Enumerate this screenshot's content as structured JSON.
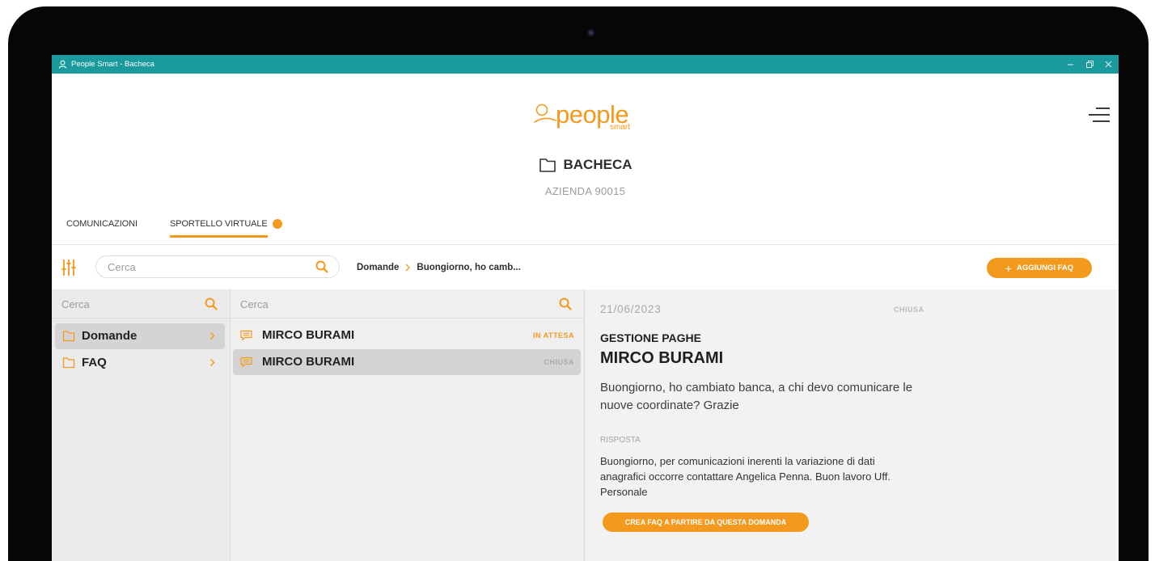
{
  "window": {
    "title": "People Smart - Bacheca"
  },
  "logo": {
    "word": "people",
    "sub": "smart"
  },
  "header": {
    "section_title": "BACHECA",
    "company": "AZIENDA 90015"
  },
  "tabs": [
    {
      "label": "COMUNICAZIONI",
      "active": false
    },
    {
      "label": "SPORTELLO VIRTUALE",
      "active": true,
      "has_badge": true
    }
  ],
  "toolbar": {
    "search_placeholder": "Cerca",
    "breadcrumb": [
      "Domande",
      "Buongiorno, ho camb..."
    ],
    "add_faq_icon": "+",
    "add_faq_label": "AGGIUNGI FAQ"
  },
  "categories": {
    "search_placeholder": "Cerca",
    "items": [
      {
        "label": "Domande",
        "selected": true
      },
      {
        "label": "FAQ",
        "selected": false
      }
    ]
  },
  "questions": {
    "search_placeholder": "Cerca",
    "items": [
      {
        "name": "MIRCO BURAMI",
        "status": "IN ATTESA",
        "selected": false
      },
      {
        "name": "MIRCO BURAMI",
        "status": "CHIUSA",
        "selected": true
      }
    ]
  },
  "detail": {
    "date": "21/06/2023",
    "status": "CHIUSA",
    "category": "GESTIONE PAGHE",
    "author": "MIRCO BURAMI",
    "question": "Buongiorno, ho cambiato banca, a chi devo comunicare le nuove coordinate? Grazie",
    "answer_label": "RISPOSTA",
    "answer": "Buongiorno, per comunicazioni inerenti la variazione di dati anagrafici occorre contattare Angelica Penna. Buon lavoro Uff. Personale",
    "create_faq_label": "CREA FAQ A PARTIRE DA QUESTA DOMANDA"
  },
  "colors": {
    "titlebar": "#1a9a9c",
    "accent": "#f39a1e",
    "status_pending": "#f39a1e",
    "status_closed": "#ababab",
    "selected_row": "#d4d4d4",
    "device_frame": "#060606"
  },
  "icons": {
    "app": "user-icon",
    "window_controls": [
      "minimize-icon",
      "restore-icon",
      "close-icon"
    ],
    "menu": "hamburger-menu-icon",
    "section": "folder-icon",
    "filter": "filter-sliders-icon",
    "search": "search-icon",
    "category": "folder-icon",
    "chevron": "chevron-right-icon",
    "question": "chat-bubble-icon"
  }
}
